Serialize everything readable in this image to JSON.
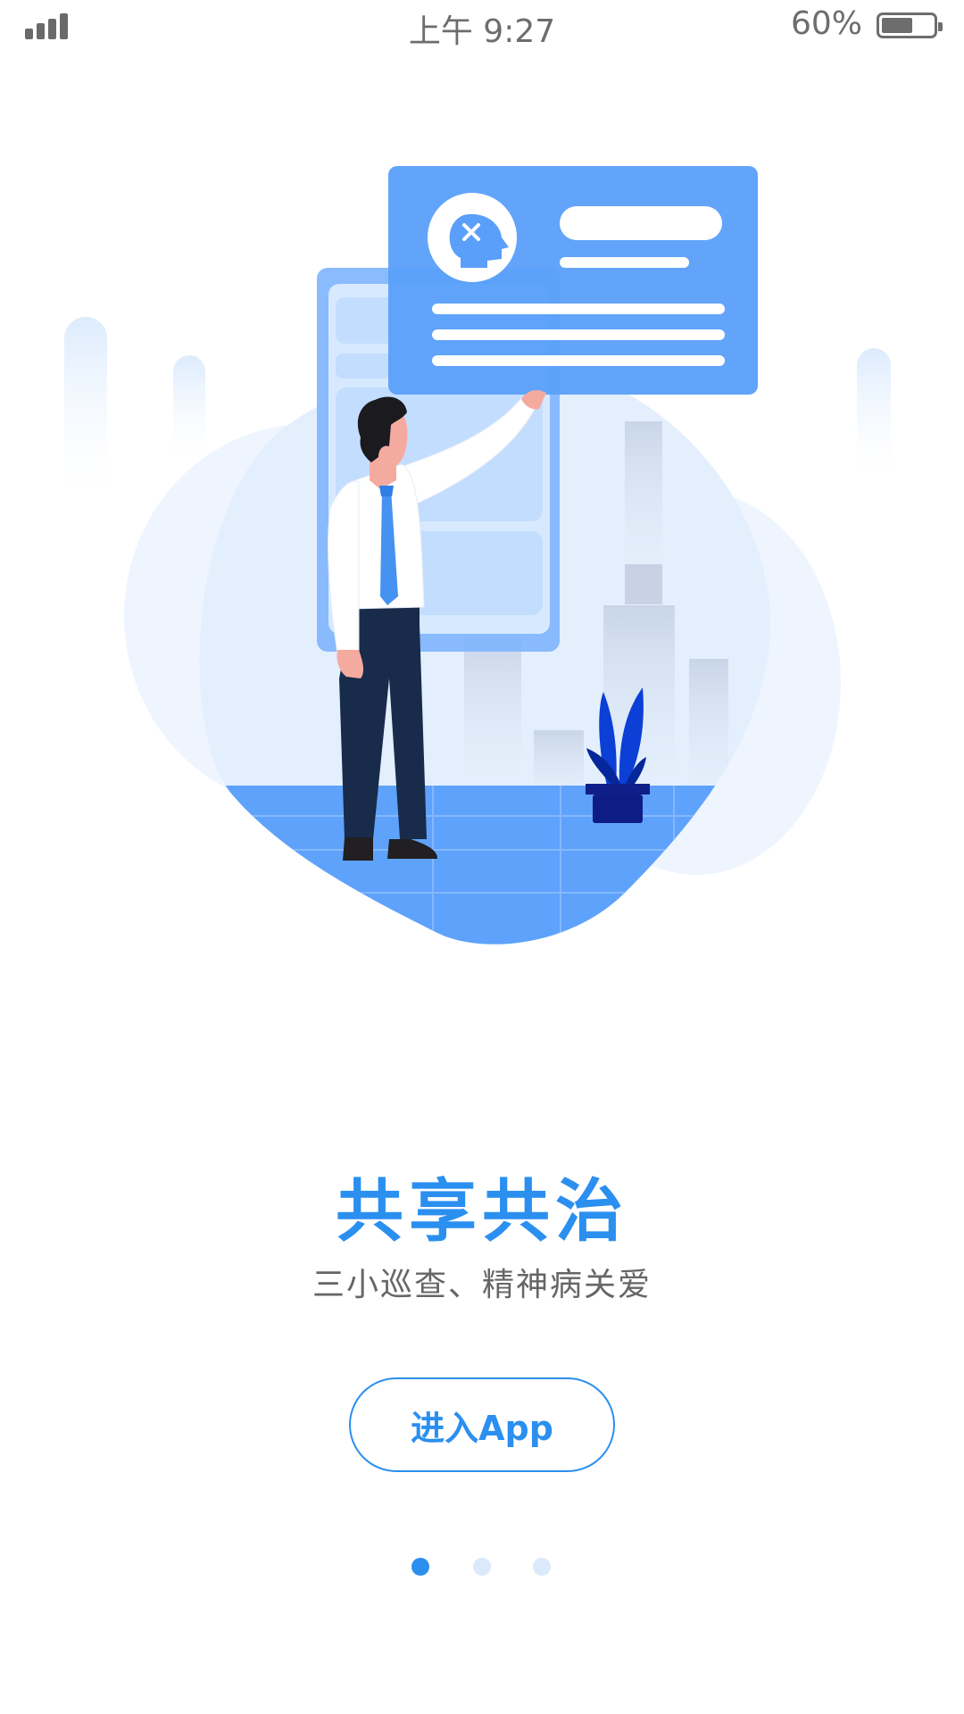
{
  "status_bar": {
    "time": "上午 9:27",
    "battery_percent": "60%",
    "battery_level": 0.6,
    "signal_icon": "signal-bars-icon",
    "battery_icon": "battery-icon"
  },
  "onboarding": {
    "title": "共享共治",
    "subtitle": "三小巡查、精神病关爱",
    "enter_button_label": "进入App",
    "illustration": "presenter-with-profile-card-illustration"
  },
  "pagination": {
    "total": 3,
    "active_index": 0
  },
  "colors": {
    "accent": "#2b8ff0",
    "card_blue": "#5a9ffa",
    "blob_light": "#e7f1fe",
    "suit_navy": "#182b4a",
    "plant_blue": "#0a3fd6",
    "dot_inactive": "#dbe9fb",
    "text_gray": "#666666"
  }
}
